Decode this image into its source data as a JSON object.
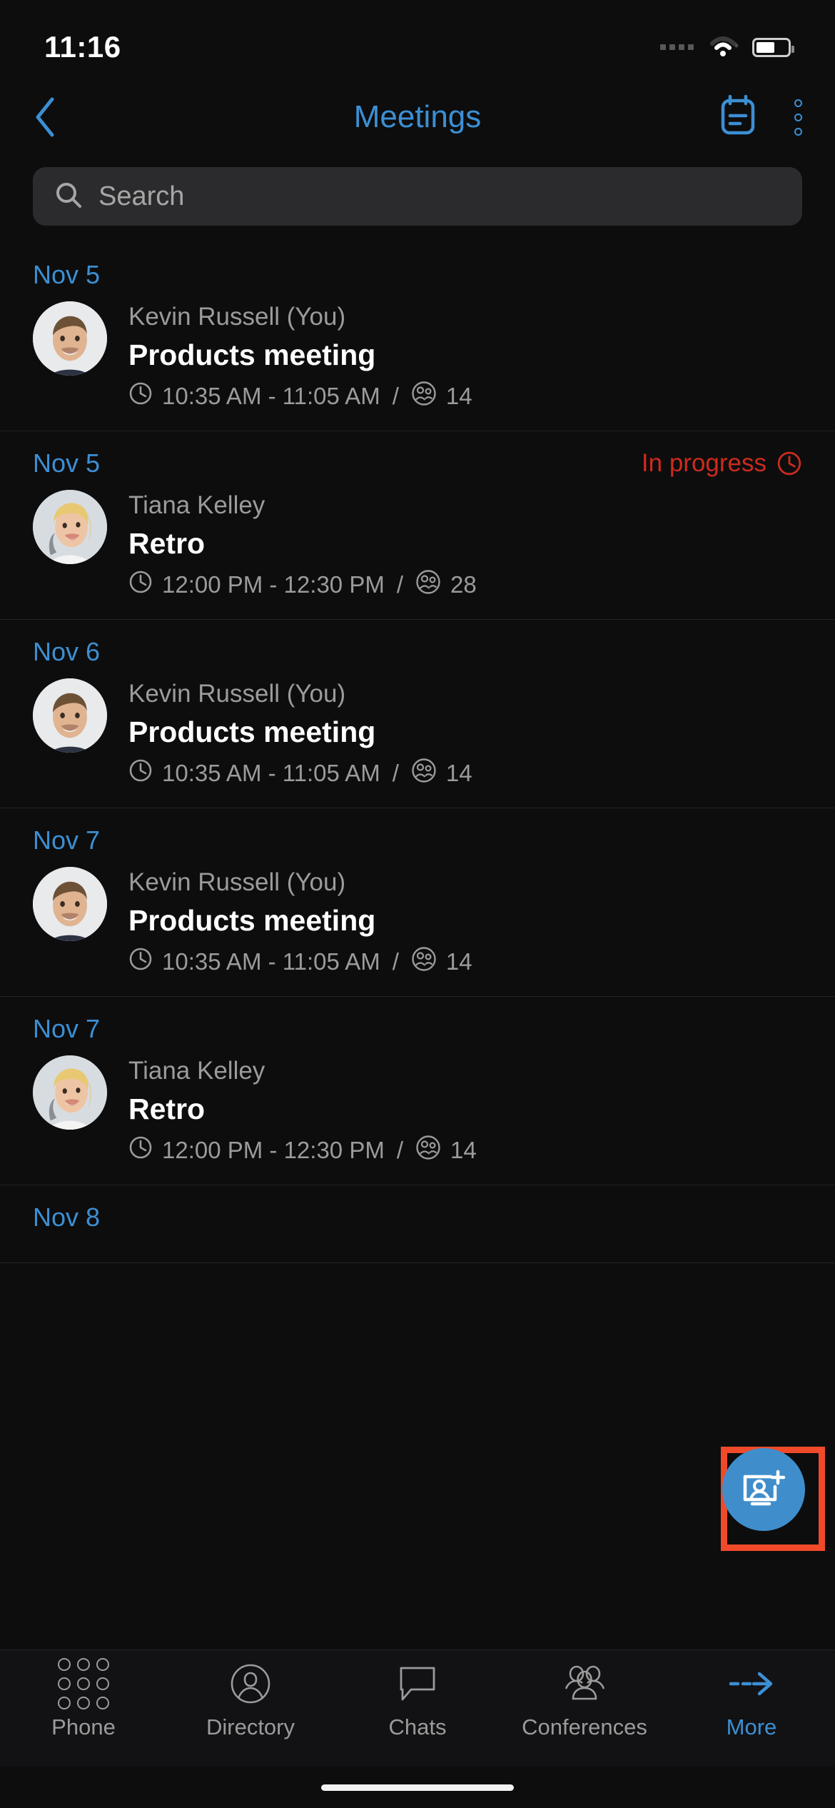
{
  "status_bar": {
    "time": "11:16",
    "signal_icon": "signal-dots-icon",
    "wifi_icon": "wifi-icon",
    "battery_icon": "battery-icon"
  },
  "nav": {
    "back_icon": "chevron-left-icon",
    "title": "Meetings",
    "calendar_icon": "calendar-icon",
    "overflow_icon": "more-vertical-icon"
  },
  "search": {
    "icon": "search-icon",
    "placeholder": "Search",
    "value": ""
  },
  "meetings": [
    {
      "date": "Nov 5",
      "status": "",
      "organizer": "Kevin Russell (You)",
      "title": "Products meeting",
      "time": "10:35 AM - 11:05 AM",
      "separator": "/",
      "participants": "14",
      "avatar": "male-avatar"
    },
    {
      "date": "Nov 5",
      "status": "In progress",
      "organizer": "Tiana Kelley",
      "title": "Retro",
      "time": "12:00 PM - 12:30 PM",
      "separator": "/",
      "participants": "28",
      "avatar": "female-avatar"
    },
    {
      "date": "Nov 6",
      "status": "",
      "organizer": "Kevin Russell (You)",
      "title": "Products meeting",
      "time": "10:35 AM - 11:05 AM",
      "separator": "/",
      "participants": "14",
      "avatar": "male-avatar"
    },
    {
      "date": "Nov 7",
      "status": "",
      "organizer": "Kevin Russell (You)",
      "title": "Products meeting",
      "time": "10:35 AM - 11:05 AM",
      "separator": "/",
      "participants": "14",
      "avatar": "male-avatar"
    },
    {
      "date": "Nov 7",
      "status": "",
      "organizer": "Tiana Kelley",
      "title": "Retro",
      "time": "12:00 PM - 12:30 PM",
      "separator": "/",
      "participants": "14",
      "avatar": "female-avatar"
    },
    {
      "date": "Nov 8",
      "status": "",
      "organizer": "",
      "title": "",
      "time": "",
      "separator": "",
      "participants": "",
      "avatar": ""
    }
  ],
  "fab": {
    "icon": "add-conference-icon",
    "highlighted": true,
    "highlight_color": "#f04a2a",
    "background_color": "#3f8ecb"
  },
  "tabbar": {
    "items": [
      {
        "label": "Phone",
        "icon": "dialpad-icon",
        "active": false
      },
      {
        "label": "Directory",
        "icon": "contact-circle-icon",
        "active": false
      },
      {
        "label": "Chats",
        "icon": "chat-bubble-icon",
        "active": false
      },
      {
        "label": "Conferences",
        "icon": "group-people-icon",
        "active": false
      },
      {
        "label": "More",
        "icon": "dashed-arrow-right-icon",
        "active": true
      }
    ]
  },
  "colors": {
    "accent": "#3c8fd4",
    "status_in_progress": "#cc2b1d",
    "background": "#0d0d0d",
    "search_field": "#2b2b2d"
  }
}
